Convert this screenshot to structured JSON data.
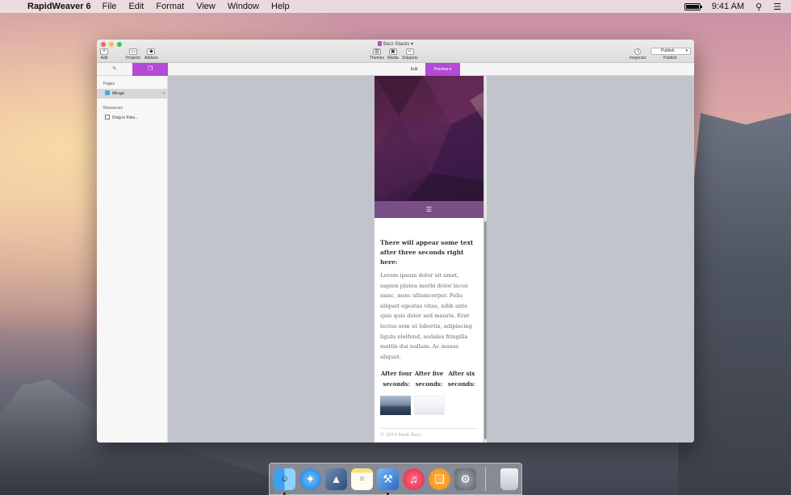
{
  "menubar": {
    "app_name": "RapidWeaver 6",
    "menus": [
      "File",
      "Edit",
      "Format",
      "View",
      "Window",
      "Help"
    ],
    "clock": "9:41 AM"
  },
  "window": {
    "title": "Barz-Stacks",
    "toolbar": {
      "add": "Add",
      "projects": "Projects",
      "addons": "Addons",
      "themes": "Themes",
      "media": "Media",
      "snippets": "Snippets",
      "inspector": "Inspector",
      "publish_button": "Publish",
      "publish_label": "Publish"
    },
    "mode_tabs": {
      "edit": "Edit",
      "preview": "Preview"
    }
  },
  "sidebar": {
    "pages_heading": "Pages",
    "pages": [
      {
        "label": "Mirage"
      }
    ],
    "resources_heading": "Resources",
    "resources": [
      {
        "label": "Drag in Files..."
      }
    ]
  },
  "preview": {
    "nav_icon": "☰",
    "lead_text": "There will appear some text after three seconds right here:",
    "body_text": "Lorem ipsum dolor sit amet, sapien platea morbi dolor lacus nunc, nunc ullamcorper. Felis aliquet egestas vitae, nibh ante quis quis dolor sed mauris. Erat lectus sem ut lobortis, adipiscing ligula eleifend, sodales fringilla mattis dui nullam. Ac massa aliquet.",
    "columns": [
      "After four seconds:",
      "After five seconds:",
      "After six seconds:"
    ],
    "footer": "© 2014 Maik Barz"
  },
  "dock": {
    "apps": [
      "finder-icon",
      "safari-icon",
      "preview-icon",
      "notes-icon",
      "xcode-icon",
      "itunes-icon",
      "ibooks-icon",
      "system-preferences-icon",
      "trash-icon"
    ]
  },
  "colors": {
    "accent": "#b34ad8",
    "hero": "#5f2852",
    "navbar": "#7a4f87",
    "canvas": "#c1c5cb"
  }
}
